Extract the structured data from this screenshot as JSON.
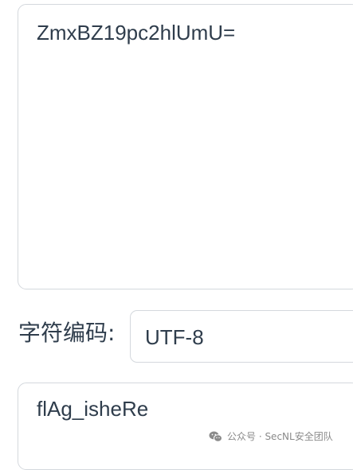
{
  "input": {
    "value": "ZmxBZ19pc2hlUmU="
  },
  "encoding": {
    "label": "字符编码:",
    "selected": "UTF-8"
  },
  "output": {
    "value": "flAg_isheRe"
  },
  "watermark": {
    "icon": "wechat-icon",
    "text": "公众号 · SecNL安全团队"
  }
}
